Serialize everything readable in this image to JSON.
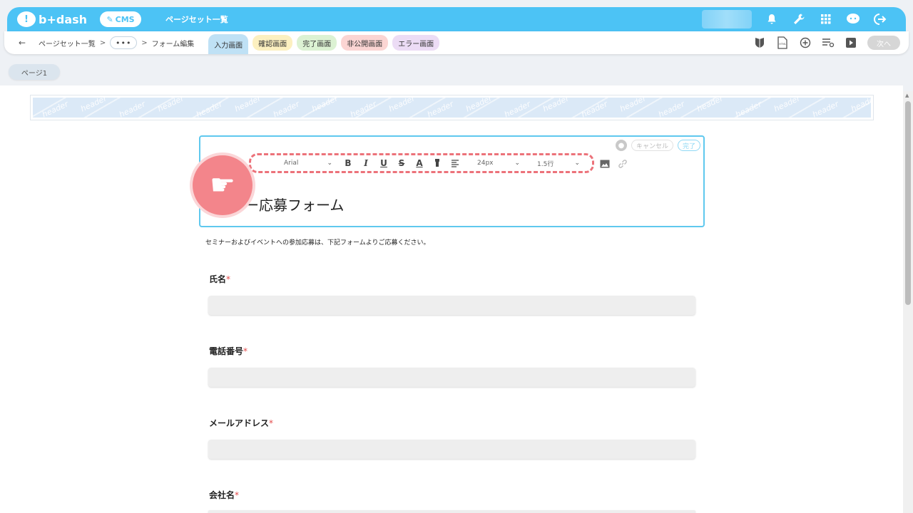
{
  "app": {
    "logo_text": "b+dash",
    "logo_mark": "!",
    "cms_label": "CMS",
    "top_title": "ページセット一覧"
  },
  "top_icons": [
    "bell-icon",
    "wrench-icon",
    "grid-icon",
    "chat-icon",
    "logout-icon"
  ],
  "breadcrumb": {
    "back": "←",
    "items": [
      "ページセット一覧",
      "フォーム編集"
    ],
    "separator": ">",
    "ellipsis": "•••"
  },
  "tabs": [
    {
      "label": "入力画面",
      "active": true,
      "color": "#bfe1f5"
    },
    {
      "label": "確認画面",
      "active": false,
      "color": "#fcf0c0"
    },
    {
      "label": "完了画面",
      "active": false,
      "color": "#dcf2d3"
    },
    {
      "label": "非公開画面",
      "active": false,
      "color": "#fbd5d3"
    },
    {
      "label": "エラー画面",
      "active": false,
      "color": "#ecdcf5"
    }
  ],
  "sub_icons": [
    "shield-icon",
    "html-file-icon",
    "add-circle-icon",
    "list-settings-icon",
    "play-icon"
  ],
  "next_label": "次へ",
  "page_tab": "ページ1",
  "header_banner_word": "header",
  "editor": {
    "cancel_label": "キャンセル",
    "done_label": "完了",
    "font": "Arial",
    "size": "24px",
    "line_height": "1.5行",
    "bold": "B",
    "italic": "I",
    "underline": "U",
    "strike": "S",
    "font_color": "A",
    "title": "ー応募フォーム"
  },
  "description": "セミナーおよびイベントへの参加応募は、下記フォームよりご応募ください。",
  "form_fields": [
    {
      "label": "氏名",
      "required_mark": "*"
    },
    {
      "label": "電話番号",
      "required_mark": "*"
    },
    {
      "label": "メールアドレス",
      "required_mark": "*"
    },
    {
      "label": "会社名",
      "required_mark": "*"
    }
  ],
  "colors": {
    "brand": "#4cc3f5",
    "highlight": "#ec727a",
    "required": "#e34a4a"
  }
}
